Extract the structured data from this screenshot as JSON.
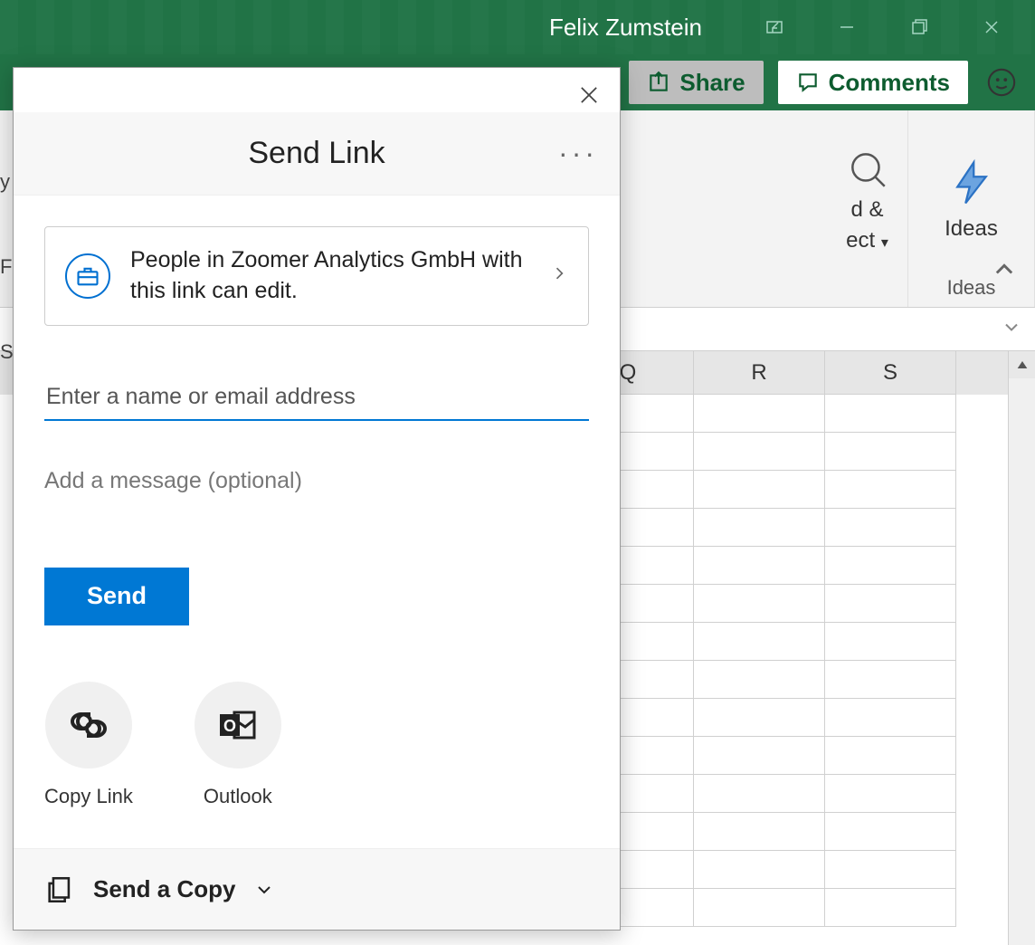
{
  "titlebar": {
    "user_name": "Felix Zumstein"
  },
  "ribbon_top": {
    "share_label": "Share",
    "comments_label": "Comments"
  },
  "ribbon": {
    "group1_top": "d &",
    "group1_bottom": "ect",
    "group2_label": "Ideas",
    "group2_item": "Ideas"
  },
  "columns": [
    "Q",
    "R",
    "S"
  ],
  "dialog": {
    "title": "Send Link",
    "permission_text": "People in Zoomer Analytics GmbH with this link can edit.",
    "name_placeholder": "Enter a name or email address",
    "message_placeholder": "Add a message (optional)",
    "send_label": "Send",
    "copy_link_label": "Copy Link",
    "outlook_label": "Outlook",
    "footer_label": "Send a Copy"
  },
  "edge_labels": [
    "y",
    "Fo",
    "St"
  ]
}
